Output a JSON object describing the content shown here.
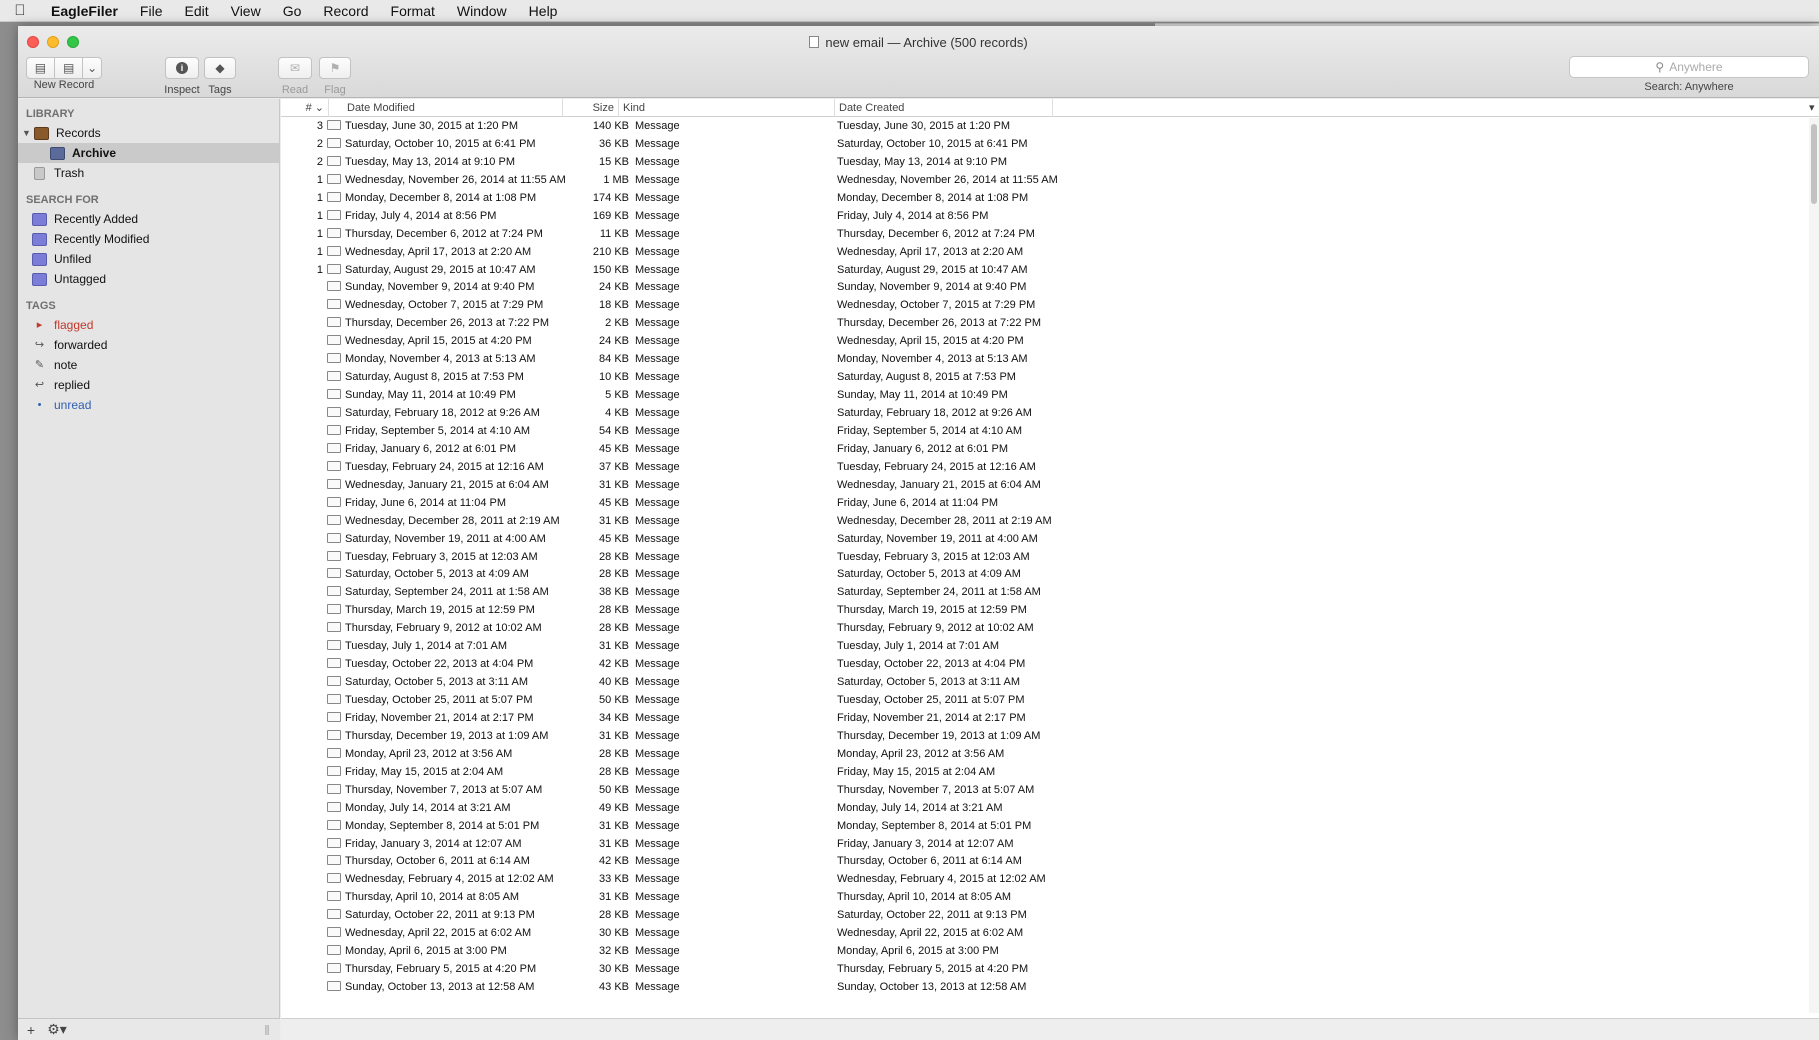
{
  "menubar": {
    "app_name": "EagleFiler",
    "items": [
      "File",
      "Edit",
      "View",
      "Go",
      "Record",
      "Format",
      "Window",
      "Help"
    ]
  },
  "window": {
    "title": "new email — Archive (500 records)"
  },
  "toolbar": {
    "new_record": "New Record",
    "inspect": "Inspect",
    "tags": "Tags",
    "read": "Read",
    "flag": "Flag",
    "search_placeholder": "Anywhere",
    "search_caption": "Search: Anywhere"
  },
  "sidebar": {
    "library_head": "LIBRARY",
    "records": "Records",
    "archive": "Archive",
    "trash": "Trash",
    "search_head": "SEARCH FOR",
    "searches": [
      "Recently Added",
      "Recently Modified",
      "Unfiled",
      "Untagged"
    ],
    "tags_head": "TAGS",
    "tags": [
      {
        "label": "flagged",
        "icon": "flag-icon",
        "color": "#c0392b"
      },
      {
        "label": "forwarded",
        "icon": "forward-icon",
        "color": "#222222"
      },
      {
        "label": "note",
        "icon": "note-icon",
        "color": "#222222"
      },
      {
        "label": "replied",
        "icon": "reply-icon",
        "color": "#222222"
      },
      {
        "label": "unread",
        "icon": "dot-icon",
        "color": "#2f5fb3"
      }
    ]
  },
  "table": {
    "columns": {
      "num": "#",
      "date_modified": "Date Modified",
      "size": "Size",
      "kind": "Kind",
      "date_created": "Date Created"
    },
    "rows": [
      [
        "3",
        "Tuesday, June 30, 2015 at 1:20 PM",
        "140 KB",
        "Message",
        "Tuesday, June 30, 2015 at 1:20 PM"
      ],
      [
        "2",
        "Saturday, October 10, 2015 at 6:41 PM",
        "36 KB",
        "Message",
        "Saturday, October 10, 2015 at 6:41 PM"
      ],
      [
        "2",
        "Tuesday, May 13, 2014 at 9:10 PM",
        "15 KB",
        "Message",
        "Tuesday, May 13, 2014 at 9:10 PM"
      ],
      [
        "1",
        "Wednesday, November 26, 2014 at 11:55 AM",
        "1 MB",
        "Message",
        "Wednesday, November 26, 2014 at 11:55 AM"
      ],
      [
        "1",
        "Monday, December 8, 2014 at 1:08 PM",
        "174 KB",
        "Message",
        "Monday, December 8, 2014 at 1:08 PM"
      ],
      [
        "1",
        "Friday, July 4, 2014 at 8:56 PM",
        "169 KB",
        "Message",
        "Friday, July 4, 2014 at 8:56 PM"
      ],
      [
        "1",
        "Thursday, December 6, 2012 at 7:24 PM",
        "11 KB",
        "Message",
        "Thursday, December 6, 2012 at 7:24 PM"
      ],
      [
        "1",
        "Wednesday, April 17, 2013 at 2:20 AM",
        "210 KB",
        "Message",
        "Wednesday, April 17, 2013 at 2:20 AM"
      ],
      [
        "1",
        "Saturday, August 29, 2015 at 10:47 AM",
        "150 KB",
        "Message",
        "Saturday, August 29, 2015 at 10:47 AM"
      ],
      [
        "",
        "Sunday, November 9, 2014 at 9:40 PM",
        "24 KB",
        "Message",
        "Sunday, November 9, 2014 at 9:40 PM"
      ],
      [
        "",
        "Wednesday, October 7, 2015 at 7:29 PM",
        "18 KB",
        "Message",
        "Wednesday, October 7, 2015 at 7:29 PM"
      ],
      [
        "",
        "Thursday, December 26, 2013 at 7:22 PM",
        "2 KB",
        "Message",
        "Thursday, December 26, 2013 at 7:22 PM"
      ],
      [
        "",
        "Wednesday, April 15, 2015 at 4:20 PM",
        "24 KB",
        "Message",
        "Wednesday, April 15, 2015 at 4:20 PM"
      ],
      [
        "",
        "Monday, November 4, 2013 at 5:13 AM",
        "84 KB",
        "Message",
        "Monday, November 4, 2013 at 5:13 AM"
      ],
      [
        "",
        "Saturday, August 8, 2015 at 7:53 PM",
        "10 KB",
        "Message",
        "Saturday, August 8, 2015 at 7:53 PM"
      ],
      [
        "",
        "Sunday, May 11, 2014 at 10:49 PM",
        "5 KB",
        "Message",
        "Sunday, May 11, 2014 at 10:49 PM"
      ],
      [
        "",
        "Saturday, February 18, 2012 at 9:26 AM",
        "4 KB",
        "Message",
        "Saturday, February 18, 2012 at 9:26 AM"
      ],
      [
        "",
        "Friday, September 5, 2014 at 4:10 AM",
        "54 KB",
        "Message",
        "Friday, September 5, 2014 at 4:10 AM"
      ],
      [
        "",
        "Friday, January 6, 2012 at 6:01 PM",
        "45 KB",
        "Message",
        "Friday, January 6, 2012 at 6:01 PM"
      ],
      [
        "",
        "Tuesday, February 24, 2015 at 12:16 AM",
        "37 KB",
        "Message",
        "Tuesday, February 24, 2015 at 12:16 AM"
      ],
      [
        "",
        "Wednesday, January 21, 2015 at 6:04 AM",
        "31 KB",
        "Message",
        "Wednesday, January 21, 2015 at 6:04 AM"
      ],
      [
        "",
        "Friday, June 6, 2014 at 11:04 PM",
        "45 KB",
        "Message",
        "Friday, June 6, 2014 at 11:04 PM"
      ],
      [
        "",
        "Wednesday, December 28, 2011 at 2:19 AM",
        "31 KB",
        "Message",
        "Wednesday, December 28, 2011 at 2:19 AM"
      ],
      [
        "",
        "Saturday, November 19, 2011 at 4:00 AM",
        "45 KB",
        "Message",
        "Saturday, November 19, 2011 at 4:00 AM"
      ],
      [
        "",
        "Tuesday, February 3, 2015 at 12:03 AM",
        "28 KB",
        "Message",
        "Tuesday, February 3, 2015 at 12:03 AM"
      ],
      [
        "",
        "Saturday, October 5, 2013 at 4:09 AM",
        "28 KB",
        "Message",
        "Saturday, October 5, 2013 at 4:09 AM"
      ],
      [
        "",
        "Saturday, September 24, 2011 at 1:58 AM",
        "38 KB",
        "Message",
        "Saturday, September 24, 2011 at 1:58 AM"
      ],
      [
        "",
        "Thursday, March 19, 2015 at 12:59 PM",
        "28 KB",
        "Message",
        "Thursday, March 19, 2015 at 12:59 PM"
      ],
      [
        "",
        "Thursday, February 9, 2012 at 10:02 AM",
        "28 KB",
        "Message",
        "Thursday, February 9, 2012 at 10:02 AM"
      ],
      [
        "",
        "Tuesday, July 1, 2014 at 7:01 AM",
        "31 KB",
        "Message",
        "Tuesday, July 1, 2014 at 7:01 AM"
      ],
      [
        "",
        "Tuesday, October 22, 2013 at 4:04 PM",
        "42 KB",
        "Message",
        "Tuesday, October 22, 2013 at 4:04 PM"
      ],
      [
        "",
        "Saturday, October 5, 2013 at 3:11 AM",
        "40 KB",
        "Message",
        "Saturday, October 5, 2013 at 3:11 AM"
      ],
      [
        "",
        "Tuesday, October 25, 2011 at 5:07 PM",
        "50 KB",
        "Message",
        "Tuesday, October 25, 2011 at 5:07 PM"
      ],
      [
        "",
        "Friday, November 21, 2014 at 2:17 PM",
        "34 KB",
        "Message",
        "Friday, November 21, 2014 at 2:17 PM"
      ],
      [
        "",
        "Thursday, December 19, 2013 at 1:09 AM",
        "31 KB",
        "Message",
        "Thursday, December 19, 2013 at 1:09 AM"
      ],
      [
        "",
        "Monday, April 23, 2012 at 3:56 AM",
        "28 KB",
        "Message",
        "Monday, April 23, 2012 at 3:56 AM"
      ],
      [
        "",
        "Friday, May 15, 2015 at 2:04 AM",
        "28 KB",
        "Message",
        "Friday, May 15, 2015 at 2:04 AM"
      ],
      [
        "",
        "Thursday, November 7, 2013 at 5:07 AM",
        "50 KB",
        "Message",
        "Thursday, November 7, 2013 at 5:07 AM"
      ],
      [
        "",
        "Monday, July 14, 2014 at 3:21 AM",
        "49 KB",
        "Message",
        "Monday, July 14, 2014 at 3:21 AM"
      ],
      [
        "",
        "Monday, September 8, 2014 at 5:01 PM",
        "31 KB",
        "Message",
        "Monday, September 8, 2014 at 5:01 PM"
      ],
      [
        "",
        "Friday, January 3, 2014 at 12:07 AM",
        "31 KB",
        "Message",
        "Friday, January 3, 2014 at 12:07 AM"
      ],
      [
        "",
        "Thursday, October 6, 2011 at 6:14 AM",
        "42 KB",
        "Message",
        "Thursday, October 6, 2011 at 6:14 AM"
      ],
      [
        "",
        "Wednesday, February 4, 2015 at 12:02 AM",
        "33 KB",
        "Message",
        "Wednesday, February 4, 2015 at 12:02 AM"
      ],
      [
        "",
        "Thursday, April 10, 2014 at 8:05 AM",
        "31 KB",
        "Message",
        "Thursday, April 10, 2014 at 8:05 AM"
      ],
      [
        "",
        "Saturday, October 22, 2011 at 9:13 PM",
        "28 KB",
        "Message",
        "Saturday, October 22, 2011 at 9:13 PM"
      ],
      [
        "",
        "Wednesday, April 22, 2015 at 6:02 AM",
        "30 KB",
        "Message",
        "Wednesday, April 22, 2015 at 6:02 AM"
      ],
      [
        "",
        "Monday, April 6, 2015 at 3:00 PM",
        "32 KB",
        "Message",
        "Monday, April 6, 2015 at 3:00 PM"
      ],
      [
        "",
        "Thursday, February 5, 2015 at 4:20 PM",
        "30 KB",
        "Message",
        "Thursday, February 5, 2015 at 4:20 PM"
      ],
      [
        "",
        "Sunday, October 13, 2013 at 12:58 AM",
        "43 KB",
        "Message",
        "Sunday, October 13, 2013 at 12:58 AM"
      ]
    ]
  }
}
